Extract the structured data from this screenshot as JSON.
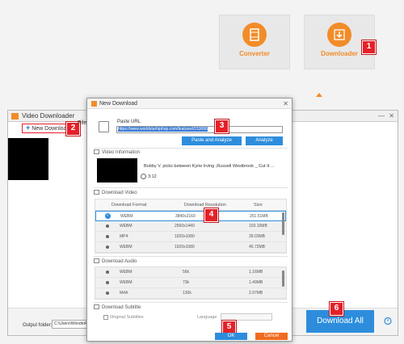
{
  "tiles": {
    "converter_label": "Converter",
    "downloader_label": "Downloader"
  },
  "badges": [
    "1",
    "2",
    "3",
    "4",
    "5",
    "6"
  ],
  "vd_window": {
    "title": "Video Downloader",
    "new_download_label": "New Download",
    "file_label_partial": "File",
    "output_folder_label": "Output folder:",
    "output_path": "C:\\Users\\WonderFox",
    "download_all_label": "Download All"
  },
  "dialog": {
    "title": "New Download",
    "paste_url_label": "Paste URL",
    "url_value": "https://www.worldstarhiphop.com/featured/153066",
    "paste_analyze_label": "Paste and Analyze",
    "analyze_label": "Analyze",
    "video_info_label": "Video Information",
    "video_title": "Bobby V. picks between Kyrie Irving ,Russell Westbrook _ Cut It ...",
    "video_duration": "3:12",
    "download_video_label": "Download Video",
    "video_headers": [
      "Download Format",
      "Download Resolution",
      "Size"
    ],
    "video_rows": [
      {
        "format": "WEBM",
        "resolution": "3840x2160",
        "size": "251.51MB",
        "selected": true
      },
      {
        "format": "WEBM",
        "resolution": "2560x1440",
        "size": "103.10MB",
        "selected": false
      },
      {
        "format": "MP4",
        "resolution": "1920x1080",
        "size": "39.03MB",
        "selected": false
      },
      {
        "format": "WEBM",
        "resolution": "1920x1080",
        "size": "45.72MB",
        "selected": false
      }
    ],
    "download_audio_label": "Download Audio",
    "audio_rows": [
      {
        "format": "WEBM",
        "bitrate": "56k",
        "size": "1.16MB"
      },
      {
        "format": "WEBM",
        "bitrate": "73k",
        "size": "1.49MB"
      },
      {
        "format": "M4A",
        "bitrate": "130k",
        "size": "2.97MB"
      }
    ],
    "download_subtitle_label": "Download Subtitle",
    "original_subtitles_label": "Original Subtitles",
    "language_label": "Language",
    "ok_label": "OK",
    "cancel_label": "Cancel"
  },
  "colors": {
    "accent_orange": "#f28c28",
    "button_blue": "#2d8ddc",
    "badge_red": "#e52028",
    "cancel_orange": "#f06b1f"
  }
}
